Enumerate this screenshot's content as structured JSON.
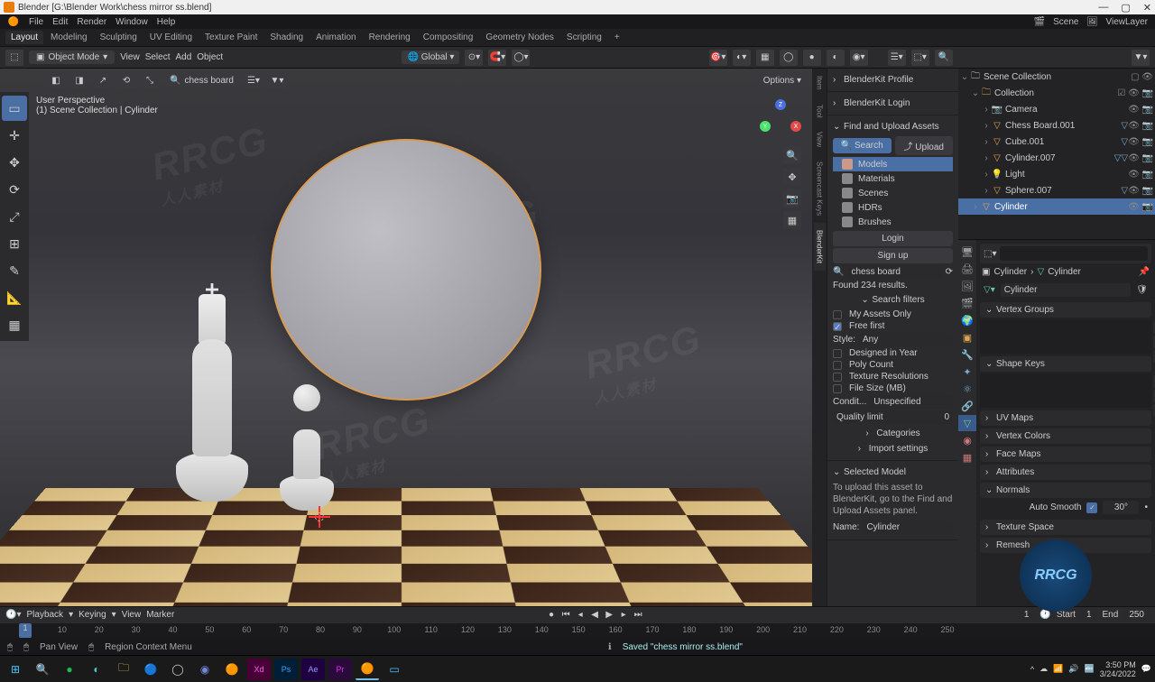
{
  "titlebar": {
    "app": "Blender",
    "file_path": "[G:\\Blender Work\\chess mirror ss.blend]"
  },
  "win_controls": {
    "min": "—",
    "max": "▢",
    "close": "✕"
  },
  "menubar": {
    "items": [
      "File",
      "Edit",
      "Render",
      "Window",
      "Help"
    ],
    "scene_label": "Scene",
    "viewlayer_label": "ViewLayer"
  },
  "workspaces": [
    "Layout",
    "Modeling",
    "Sculpting",
    "UV Editing",
    "Texture Paint",
    "Shading",
    "Animation",
    "Rendering",
    "Compositing",
    "Geometry Nodes",
    "Scripting",
    "+"
  ],
  "active_workspace": 0,
  "tool_header": {
    "mode": "Object Mode",
    "menus": [
      "View",
      "Select",
      "Add",
      "Object"
    ],
    "orientation": "Global",
    "options_label": "Options"
  },
  "viewport": {
    "search_value": "chess board",
    "perspective": "User Perspective",
    "context": "(1) Scene Collection | Cylinder"
  },
  "blenderkit": {
    "sections_closed": [
      "BlenderKit Profile",
      "BlenderKit Login"
    ],
    "section_open": "Find and Upload Assets",
    "search_btn": "Search",
    "upload_btn": "Upload",
    "asset_types": [
      "Models",
      "Materials",
      "Scenes",
      "HDRs",
      "Brushes"
    ],
    "active_type": 0,
    "login": "Login",
    "signup": "Sign up",
    "search_value": "chess board",
    "results": "Found 234 results.",
    "filters_h": "Search filters",
    "my_assets": "My Assets Only",
    "free_first": "Free first",
    "style_label": "Style:",
    "style_value": "Any",
    "designed": "Designed in Year",
    "poly": "Poly Count",
    "texres": "Texture Resolutions",
    "filesize": "File Size (MB)",
    "condit_label": "Condit...",
    "condit_value": "Unspecified",
    "quality": "Quality limit",
    "quality_val": "0",
    "categories": "Categories",
    "import_settings": "Import settings",
    "selected_h": "Selected Model",
    "upload_hint": "To upload this asset to BlenderKit, go to the Find and Upload Assets panel.",
    "name_label": "Name:",
    "name_value": "Cylinder",
    "vtabs": [
      "Item",
      "Tool",
      "View",
      "Screencast Keys",
      "BlenderKit"
    ]
  },
  "outliner": {
    "root": "Scene Collection",
    "collection": "Collection",
    "items": [
      {
        "name": "Camera",
        "icon": "📷"
      },
      {
        "name": "Chess Board.001",
        "icon": "▽",
        "mod": "▽"
      },
      {
        "name": "Cube.001",
        "icon": "▽",
        "mod": "▽"
      },
      {
        "name": "Cylinder.007",
        "icon": "▽",
        "mod": "▽ ▽"
      },
      {
        "name": "Light",
        "icon": "💡"
      },
      {
        "name": "Sphere.007",
        "icon": "▽",
        "mod": "▽"
      },
      {
        "name": "Cylinder",
        "icon": "▽",
        "sel": true
      }
    ]
  },
  "properties": {
    "breadcrumb_obj": "Cylinder",
    "breadcrumb_data": "Cylinder",
    "data_name": "Cylinder",
    "panels": [
      {
        "name": "Vertex Groups",
        "open": true,
        "empty": true
      },
      {
        "name": "Shape Keys",
        "open": true,
        "empty": true
      },
      {
        "name": "UV Maps",
        "open": false
      },
      {
        "name": "Vertex Colors",
        "open": false
      },
      {
        "name": "Face Maps",
        "open": false
      },
      {
        "name": "Attributes",
        "open": false
      },
      {
        "name": "Normals",
        "open": true
      },
      {
        "name": "Texture Space",
        "open": false
      },
      {
        "name": "Remesh",
        "open": false
      }
    ],
    "auto_smooth": "Auto Smooth",
    "auto_smooth_angle": "30°"
  },
  "timeline": {
    "playback": "Playback",
    "keying": "Keying",
    "menus": [
      "View",
      "Marker"
    ],
    "current": "1",
    "start_label": "Start",
    "start": "1",
    "end_label": "End",
    "end": "250",
    "ticks": [
      "10",
      "20",
      "30",
      "40",
      "50",
      "60",
      "70",
      "80",
      "90",
      "100",
      "110",
      "120",
      "130",
      "140",
      "150",
      "160",
      "170",
      "180",
      "190",
      "200",
      "210",
      "220",
      "230",
      "240",
      "250"
    ]
  },
  "statusbar": {
    "pan": "Pan View",
    "ctx": "Region Context Menu",
    "saved": "Saved \"chess mirror ss.blend\""
  },
  "taskbar": {
    "time": "3:50 PM",
    "date": "3/24/2022"
  },
  "watermarks": {
    "text": "RRCG",
    "sub": "人人素材"
  }
}
